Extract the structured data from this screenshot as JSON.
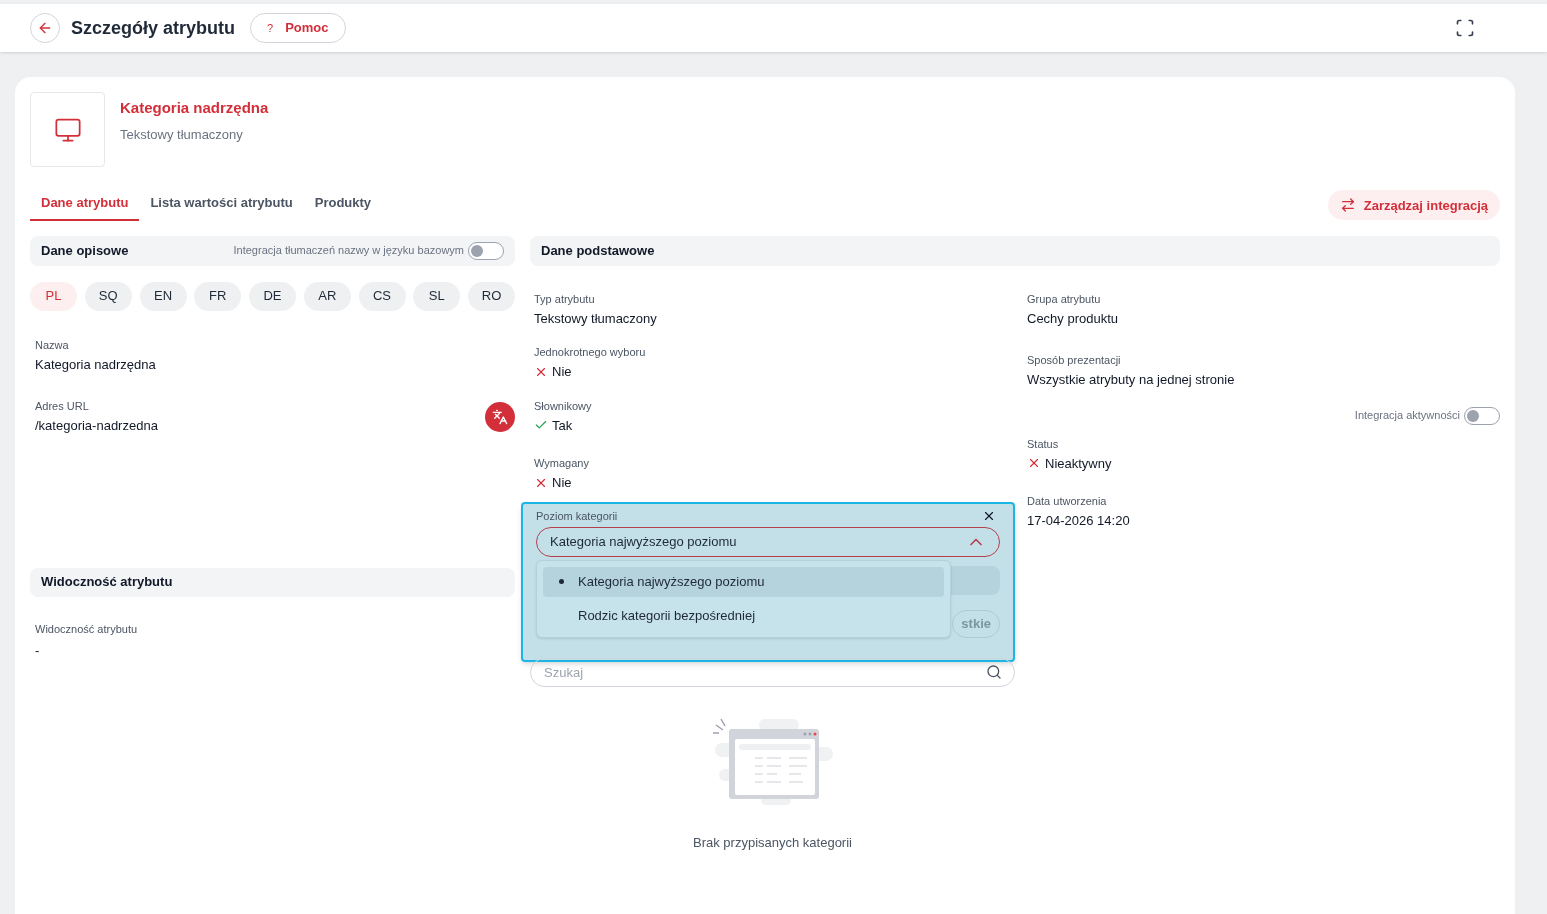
{
  "header": {
    "title": "Szczegóły atrybutu",
    "help_button": "Pomoc",
    "help_icon": "?"
  },
  "attribute": {
    "name": "Kategoria nadrzędna",
    "type": "Tekstowy tłumaczony"
  },
  "tabs": [
    {
      "label": "Dane atrybutu",
      "selected": true
    },
    {
      "label": "Lista wartości atrybutu",
      "selected": false
    },
    {
      "label": "Produkty",
      "selected": false
    }
  ],
  "manage_button": "Zarządzaj integracją",
  "descriptive": {
    "title": "Dane opisowe",
    "toggle": {
      "label": "Integracja tłumaczeń nazwy w języku bazowym",
      "on": false
    },
    "languages": [
      {
        "label": "PL",
        "selected": true
      },
      {
        "label": "SQ",
        "selected": false
      },
      {
        "label": "EN",
        "selected": false
      },
      {
        "label": "FR",
        "selected": false
      },
      {
        "label": "DE",
        "selected": false
      },
      {
        "label": "AR",
        "selected": false
      },
      {
        "label": "CS",
        "selected": false
      },
      {
        "label": "SL",
        "selected": false
      },
      {
        "label": "RO",
        "selected": false
      }
    ],
    "fields": [
      {
        "label": "Nazwa",
        "value": "Kategoria nadrzędna",
        "translate": false
      },
      {
        "label": "Adres URL",
        "value": "/kategoria-nadrzedna",
        "translate": true
      }
    ]
  },
  "visibility": {
    "title": "Widoczność atrybutu",
    "fields": [
      {
        "label": "Widoczność atrybutu",
        "value": "-"
      }
    ]
  },
  "basic": {
    "title": "Dane podstawowe",
    "left_fields": [
      {
        "kind": "text",
        "label": "Typ atrybutu",
        "value": "Tekstowy tłumaczony"
      },
      {
        "kind": "boolean",
        "label": "Jednokrotnego wyboru",
        "value": "Nie",
        "checked": false
      },
      {
        "kind": "boolean",
        "label": "Słownikowy",
        "value": "Tak",
        "checked": true
      },
      {
        "kind": "boolean",
        "label": "Wymagany",
        "value": "Nie",
        "checked": false
      }
    ],
    "category_level": {
      "label": "Poziom kategorii",
      "value": "Kategoria najwyższego poziomu",
      "expanded": true,
      "options": [
        {
          "label": "Kategoria najwyższego poziomu",
          "selected": true
        },
        {
          "label": "Rodzic kategorii bezpośredniej",
          "selected": false
        }
      ],
      "covered_button": "stkie"
    },
    "search": {
      "placeholder": "Szukaj"
    },
    "empty_state": "Brak przypisanych kategorii",
    "right_fields": [
      {
        "kind": "text",
        "label": "Grupa atrybutu",
        "value": "Cechy produktu"
      },
      {
        "kind": "text",
        "label": "Sposób prezentacji",
        "value": "Wszystkie atrybuty na jednej stronie"
      }
    ],
    "activity_toggle": {
      "label": "Integracja aktywności",
      "on": false
    },
    "status": {
      "kind": "boolean",
      "label": "Status",
      "value": "Nieaktywny",
      "checked": false
    },
    "created": {
      "kind": "text",
      "label": "Data utworzenia",
      "value": "17-04-2026 14:20"
    }
  }
}
